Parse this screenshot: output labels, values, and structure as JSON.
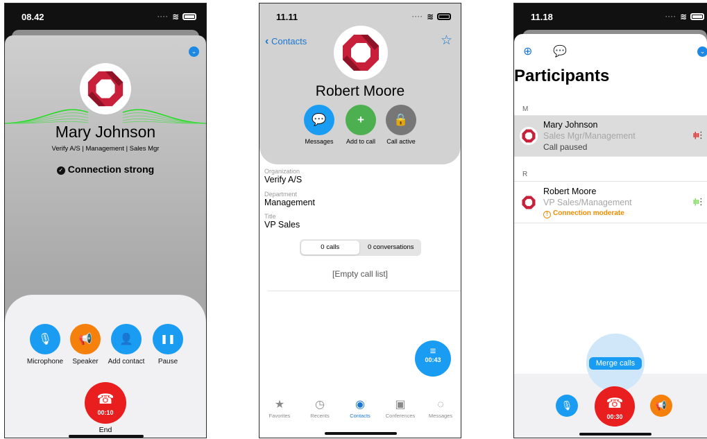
{
  "screen1": {
    "time": "08.42",
    "name": "Mary Johnson",
    "subtitle": "Verify A/S | Management | Sales Mgr",
    "connection": "Connection strong",
    "controls": [
      "Microphone",
      "Speaker",
      "Add contact",
      "Pause"
    ],
    "end_timer": "00:10",
    "end_label": "End"
  },
  "screen2": {
    "time": "11.11",
    "back_label": "Contacts",
    "name": "Robert Moore",
    "actions": [
      "Messages",
      "Add to call",
      "Call active"
    ],
    "fields": [
      {
        "label": "Organization",
        "value": "Verify A/S"
      },
      {
        "label": "Department",
        "value": "Management"
      },
      {
        "label": "Title",
        "value": "VP Sales"
      }
    ],
    "segments": [
      "0 calls",
      "0 conversations"
    ],
    "empty_text": "[Empty call list]",
    "fab_timer": "00:43",
    "tabs": [
      "Favorites",
      "Recents",
      "Contacts",
      "Conferences",
      "Messages"
    ]
  },
  "screen3": {
    "time": "11.18",
    "title": "Participants",
    "sections": [
      {
        "header": "M",
        "participant": {
          "name": "Mary Johnson",
          "role": "Sales Mgr/Management",
          "status": "Call paused"
        }
      },
      {
        "header": "R",
        "participant": {
          "name": "Robert Moore",
          "role": "VP Sales/Management",
          "status": "Connection moderate"
        }
      }
    ],
    "merge_label": "Merge calls",
    "end_timer": "00:30"
  },
  "colors": {
    "accent_blue": "#1b9cf3",
    "link_blue": "#1976d2",
    "end_red": "#e91e1e",
    "speaker_orange": "#f5800c",
    "add_green": "#4caf50",
    "warning_orange": "#f08c00",
    "wave_green": "#22dd22"
  }
}
